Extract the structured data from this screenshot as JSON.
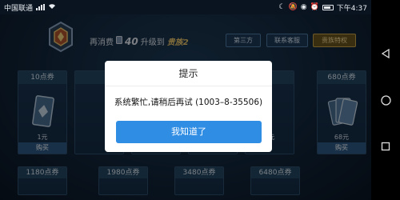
{
  "status_bar": {
    "carrier": "中国联通",
    "time": "下午4:37"
  },
  "header": {
    "spend_prefix": "再消费",
    "spend_amount": "40",
    "upgrade_text": "升级到",
    "vip_label": "贵族2",
    "buttons": [
      "第三方",
      "联系客服",
      "贵族特权"
    ]
  },
  "cards_row1": [
    {
      "title": "10点券",
      "price": "1元",
      "buy": "购买"
    },
    {
      "title": "",
      "price": "",
      "buy": ""
    },
    {
      "title": "",
      "price": "",
      "buy": ""
    },
    {
      "title": "",
      "price": "",
      "buy": ""
    },
    {
      "title": "",
      "price": "",
      "buy": ""
    },
    {
      "title": "",
      "price": "0元",
      "buy": ""
    },
    {
      "title": "680点券",
      "price": "68元",
      "buy": "购买"
    }
  ],
  "cards_row2": [
    {
      "title": "1180点券"
    },
    {
      "title": "1980点券"
    },
    {
      "title": "3480点券"
    },
    {
      "title": "6480点券"
    }
  ],
  "dialog": {
    "title": "提示",
    "message": "系统繁忙,请稍后再试 (1003–8-35506)",
    "button": "我知道了"
  },
  "colors": {
    "dialog_button": "#2f8de4",
    "accent_gold": "#e5c26a"
  }
}
